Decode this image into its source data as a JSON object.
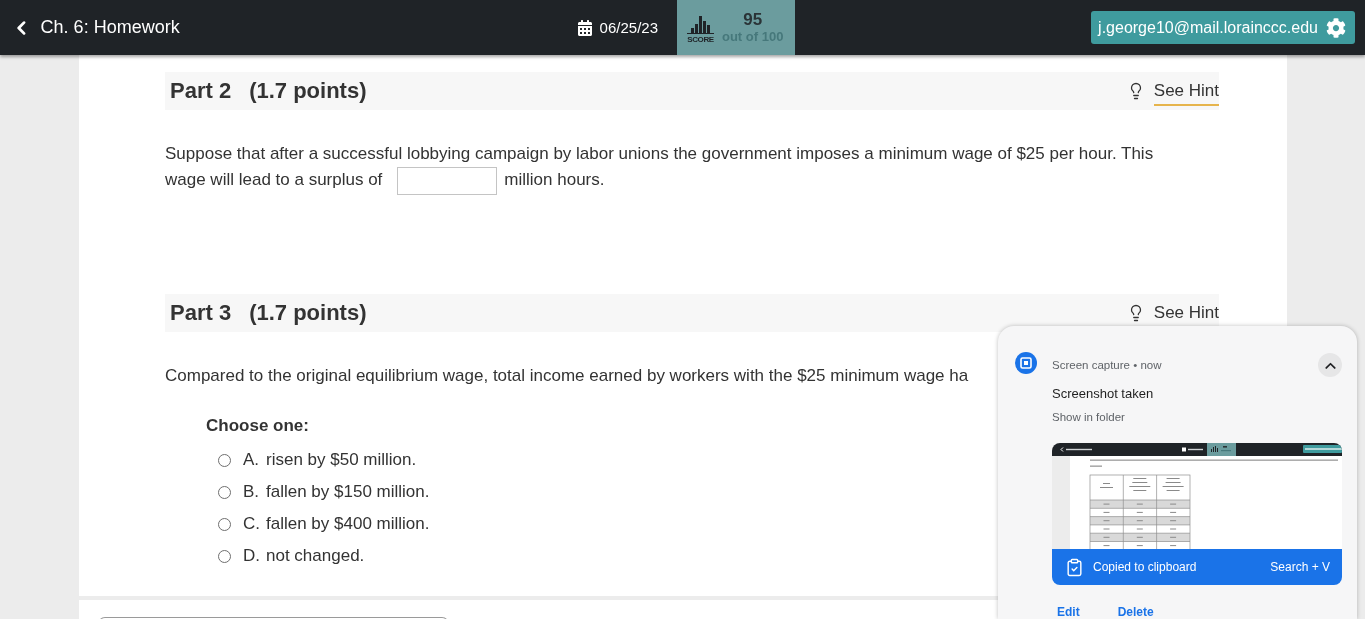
{
  "top_bar": {
    "back_label": "Ch. 6: Homework",
    "date": "06/25/23",
    "score": {
      "label": "SCORE",
      "value": "95",
      "total": "out of 100"
    },
    "account_email": "j.george10@mail.lorainccc.edu"
  },
  "parts": [
    {
      "kind": "fill_in",
      "title": "Part 2",
      "points": "(1.7 points)",
      "hint": "See Hint",
      "prompt_before": "Suppose that after a successful lobbying campaign by labor unions the government imposes a minimum wage of $25 per hour. This wage will lead to a surplus of",
      "prompt_after": "million hours."
    },
    {
      "kind": "multiple_choice",
      "title": "Part 3",
      "points": "(1.7 points)",
      "hint": "See Hint",
      "prompt": "Compared to the original equilibrium wage, total income earned by workers with the $25 minimum wage ha",
      "choose_label": "Choose one:",
      "choices": [
        {
          "letter": "A.",
          "text": "risen by $50 million.",
          "selected": false
        },
        {
          "letter": "B.",
          "text": "fallen by $150 million.",
          "selected": false
        },
        {
          "letter": "C.",
          "text": "fallen by $400 million.",
          "selected": false
        },
        {
          "letter": "D.",
          "text": "not changed.",
          "selected": false
        }
      ]
    }
  ],
  "notification": {
    "source": "Screen capture • now",
    "expanded": true,
    "title": "Screenshot taken",
    "link": "Show in folder",
    "banner": {
      "text": "Copied to clipboard",
      "shortcut": "Search + V"
    },
    "actions": [
      "Edit",
      "Delete"
    ]
  }
}
